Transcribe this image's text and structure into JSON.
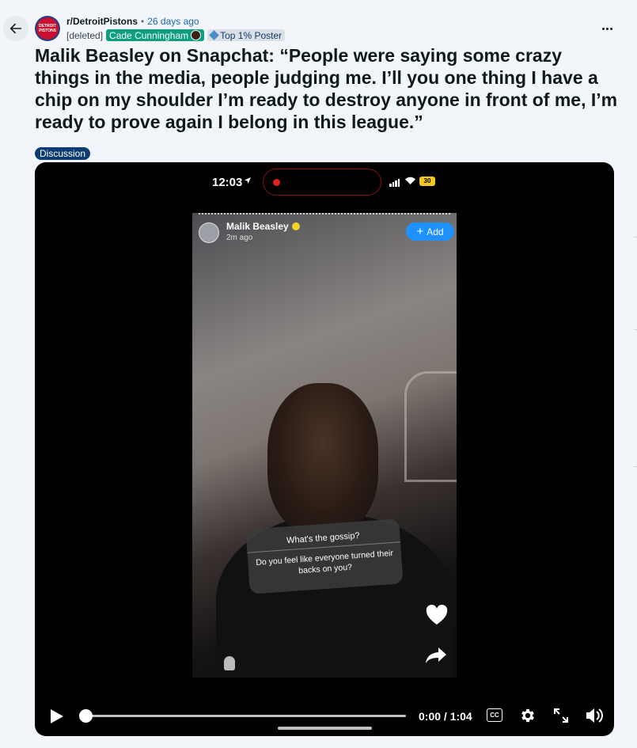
{
  "post": {
    "subreddit": "r/DetroitPistons",
    "separator": "•",
    "age": "26 days ago",
    "author": "[deleted]",
    "flair_user": "Cade Cunningham",
    "flair_badge": "Top 1% Poster",
    "title": "Malik Beasley on Snapchat: “People were saying some crazy things in the media, people judging me. I’ll you one thing I have a chip on my shoulder I’m ready to destroy anyone in front of me, I’m ready to prove again I belong in this league.”",
    "tag": "Discussion",
    "avatar_text": "DETROIT PISTONS"
  },
  "video": {
    "phone_time": "12:03",
    "battery": "30",
    "snap_user": "Malik Beasley",
    "snap_age": "2m ago",
    "snap_add_label": "Add",
    "question_title": "What's the gossip?",
    "question_text": "Do you feel like everyone turned their backs on you?",
    "timecode": "0:00 / 1:04",
    "cc_label": "CC",
    "progress": 0
  },
  "icons": {
    "back": "arrow-left-icon",
    "more": "ellipsis-icon",
    "play": "play-icon",
    "settings": "gear-icon",
    "fullscreen": "expand-icon",
    "volume": "volume-icon"
  },
  "colors": {
    "flair_user_bg": "#0c9e7e",
    "tag_bg": "#0c3c72",
    "time_link": "#1a66b3",
    "snap_add_bg": "#1e90ff"
  }
}
